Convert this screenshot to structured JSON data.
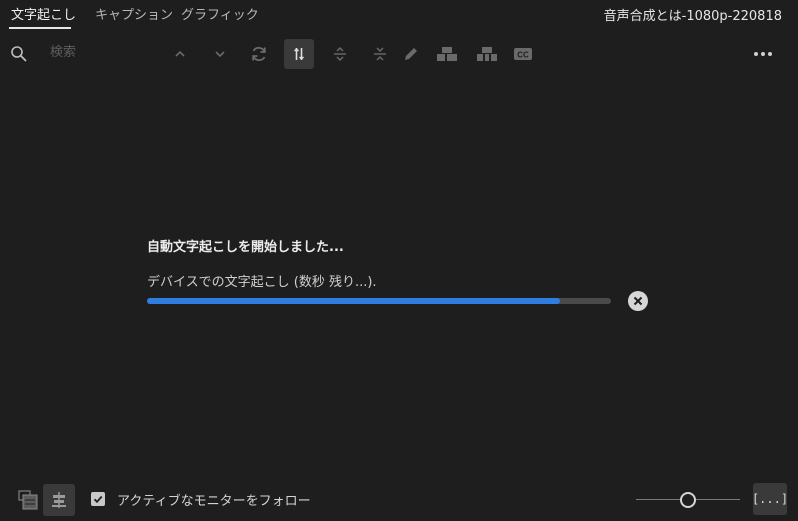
{
  "tabs": [
    {
      "label": "文字起こし",
      "active": true
    },
    {
      "label": "キャプション",
      "active": false
    },
    {
      "label": "グラフィック",
      "active": false
    }
  ],
  "sequence_title": "音声合成とは-1080p-220818",
  "search": {
    "placeholder": "検索",
    "value": ""
  },
  "toolbar_icons": [
    "search-icon",
    "chevron-up-icon",
    "chevron-down-icon",
    "refresh-icon",
    "split-icon",
    "expand-icon",
    "collapse-icon",
    "pencil-icon",
    "merge-clips-icon",
    "split-clips-icon",
    "cc-icon",
    "more-icon"
  ],
  "status": {
    "title": "自動文字起こしを開始しました...",
    "detail": "デバイスでの文字起こし (数秒 残り...).",
    "progress": 0.89
  },
  "footer": {
    "follow_monitor_label": "アクティブなモニターをフォロー",
    "follow_checked": true,
    "zoom_fraction": 0.5,
    "fit_label": "[...]"
  },
  "colors": {
    "background": "#1e1e1e",
    "accent": "#2f7de1",
    "active_button": "#3a3a3a"
  }
}
